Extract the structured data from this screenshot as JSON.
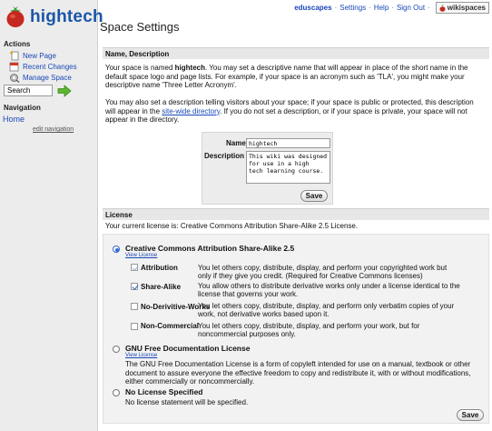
{
  "site": {
    "name": "hightech"
  },
  "topnav": {
    "site": "eduscapes",
    "settings": "Settings",
    "help": "Help",
    "signout": "Sign Out",
    "brand": "wikispaces",
    "separator": "·"
  },
  "sidebar": {
    "actions_heading": "Actions",
    "items": [
      {
        "label": "New Page",
        "icon": "new-page-icon"
      },
      {
        "label": "Recent Changes",
        "icon": "calendar-icon"
      },
      {
        "label": "Manage Space",
        "icon": "manage-space-icon"
      }
    ],
    "search_value": "Search",
    "navigation_heading": "Navigation",
    "home": "Home",
    "edit_navigation": "edit navigation"
  },
  "page": {
    "title": "Space Settings"
  },
  "name_section": {
    "heading": "Name, Description",
    "p1_a": "Your space is named ",
    "p1_name": "hightech",
    "p1_b": ". You may set a descriptive name that will appear in place of the short name in the",
    "p1_c": "default space logo and page lists. For example, if your space is an acronym such as 'TLA', you might make your",
    "p1_d": "descriptive name 'Three Letter Acronym'.",
    "p2_a": "You may also set a description telling visitors about your space; if your space is public or protected, this description",
    "p2_b": "will appear in the ",
    "p2_link": "site-wide directory",
    "p2_c": ". If you do not set a description, or if your space is private, your space will not",
    "p2_d": "appear in the directory."
  },
  "form": {
    "name_label": "Name",
    "name_value": "hightech",
    "desc_label": "Description",
    "desc_line1": "This wiki was designed for use in a high",
    "desc_line2": "tech learning course.",
    "save": "Save"
  },
  "license": {
    "heading": "License",
    "current": "Your current license is: Creative Commons Attribution Share-Alike 2.5 License.",
    "cc": {
      "title": "Creative Commons Attribution Share-Alike 2.5",
      "view": "View License",
      "options": [
        {
          "label": "Attribution",
          "l1": "You let others copy, distribute, display, and perform your copyrighted work but",
          "l2": "only if they give you credit. (Required for Creative Commons licenses)"
        },
        {
          "label": "Share-Alike",
          "l1": "You allow others to distribute derivative works only under a license identical to the",
          "l2": "license that governs your work."
        },
        {
          "label": "No-Derivitive-Works",
          "l1": "You let others copy, distribute, display, and perform only verbatim copies of your",
          "l2": "work, not derivative works based upon it."
        },
        {
          "label": "Non-Commercial",
          "l1": "You let others copy, distribute, display, and perform your work, but for",
          "l2": "noncommercial purposes only."
        }
      ]
    },
    "gnu": {
      "title": "GNU Free Documentation License",
      "view": "View License",
      "l1": "The GNU Free Documentation License is a form of copyleft intended for use on a manual, textbook or other",
      "l2": "document to assure everyone the effective freedom to copy and redistribute it, with or without modifications,",
      "l3": "either commercially or noncommercially."
    },
    "none": {
      "title": "No License Specified",
      "text": "No license statement will be specified."
    },
    "save": "Save"
  },
  "colors": {
    "link": "#1a47b8",
    "logo": "#1a56a8",
    "sidebar_bg": "#ececec",
    "section_bg": "#e7e7e7"
  }
}
